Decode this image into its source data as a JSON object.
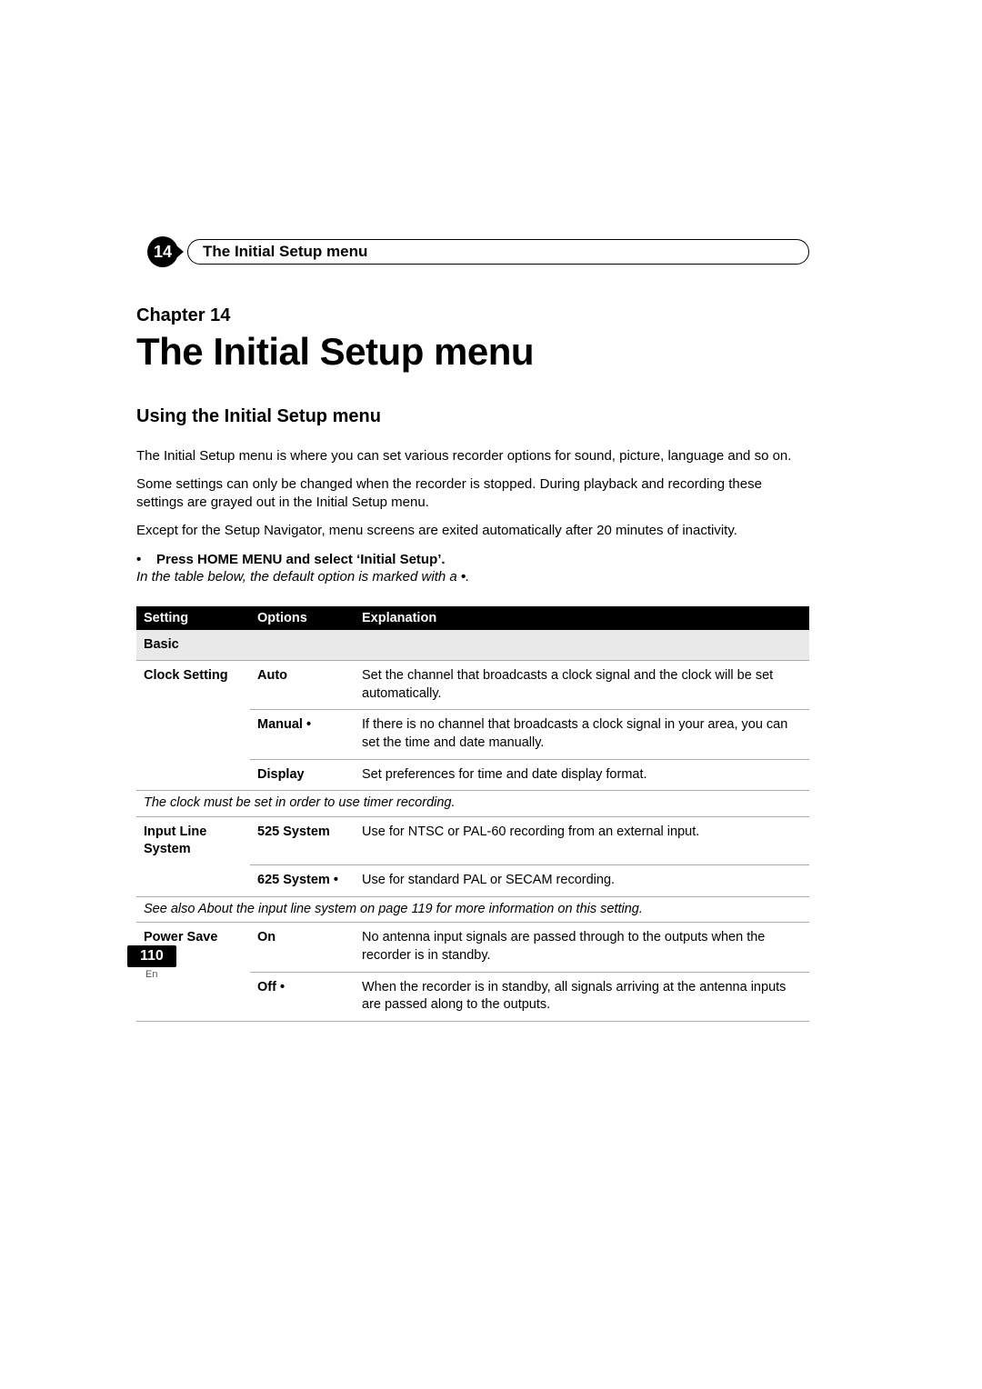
{
  "header": {
    "chapter_number": "14",
    "chapter_pill_title": "The Initial Setup menu",
    "chapter_label": "Chapter 14",
    "chapter_title": "The Initial Setup menu"
  },
  "section": {
    "title": "Using the Initial Setup menu",
    "paragraphs": [
      "The Initial Setup menu is where you can set various recorder options for sound, picture, language and so on.",
      "Some settings can only be changed when the recorder is stopped. During playback and recording these settings are grayed out in the Initial Setup menu.",
      "Except for the Setup Navigator, menu screens are exited automatically after 20 minutes of inactivity."
    ],
    "bullet": "Press HOME MENU and select ‘Initial Setup’.",
    "note_prefix": "In the table below, the default option is marked with a ",
    "note_suffix": "."
  },
  "table": {
    "columns": [
      "Setting",
      "Options",
      "Explanation"
    ],
    "group_label": "Basic",
    "rows": [
      {
        "setting": "Clock Setting",
        "option": "Auto",
        "default": false,
        "explanation": "Set the channel that broadcasts a clock signal and the clock will be set automatically."
      },
      {
        "setting": "",
        "option": "Manual",
        "default": true,
        "explanation": "If there is no channel that broadcasts a clock signal in your area, you can set the time and date manually."
      },
      {
        "setting": "",
        "option": "Display",
        "default": false,
        "explanation": "Set preferences for time and date display format."
      }
    ],
    "note1": "The clock must be set in order to use timer recording.",
    "rows2": [
      {
        "setting": "Input Line System",
        "option": "525 System",
        "default": false,
        "explanation": "Use for NTSC or PAL-60 recording from an external input."
      },
      {
        "setting": "",
        "option": "625 System",
        "default": true,
        "explanation": "Use for standard PAL or SECAM recording."
      }
    ],
    "note2": "See also About the input line system on page 119 for more information on this setting.",
    "rows3": [
      {
        "setting": "Power Save",
        "option": "On",
        "default": false,
        "explanation": "No antenna input signals are passed through to the outputs when the recorder is in standby."
      },
      {
        "setting": "",
        "option": "Off",
        "default": true,
        "explanation": "When the recorder is in standby, all signals arriving at the antenna inputs are passed along to the outputs."
      }
    ]
  },
  "footer": {
    "page_number": "110",
    "language": "En"
  }
}
